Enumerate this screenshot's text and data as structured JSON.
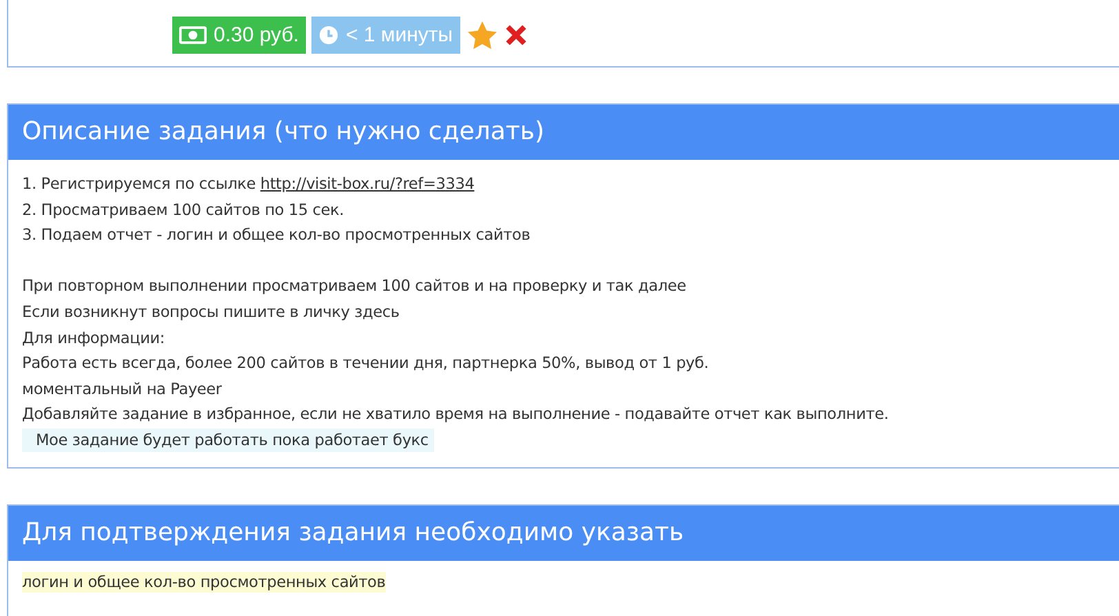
{
  "task_meta": {
    "price": "0.30 руб.",
    "duration": "< 1 минуты",
    "favorite": true
  },
  "description": {
    "title": "Описание задания (что нужно сделать)",
    "steps": [
      {
        "text": "1. Регистрируемся по ссылке ",
        "link": "http://visit-box.ru/?ref=3334"
      },
      {
        "text": "2. Просматриваем 100 сайтов по 15 сек."
      },
      {
        "text": "3. Подаем отчет - логин и общее кол-во просмотренных сайтов"
      }
    ],
    "notes": [
      {
        "text": "При повторном выполнении просматриваем 100 сайтов и на проверку и так далее",
        "highlighted": false
      },
      {
        "text": "Если возникнут вопросы пишите в личку здесь",
        "highlighted": false
      },
      {
        "text": "Для информации:",
        "highlighted": false
      },
      {
        "text": "Работа есть всегда, более 200 сайтов в течении дня, партнерка 50%, вывод от 1 руб.",
        "highlighted": false
      },
      {
        "text": "моментальный на Payeer",
        "highlighted": false
      },
      {
        "text": "Добавляйте задание в избранное, если не хватило время на выполнение - подавайте отчет как выполните.",
        "highlighted": false
      },
      {
        "text": "Мое задание будет работать пока работает букс",
        "highlighted": true
      }
    ]
  },
  "confirmation": {
    "title": "Для подтверждения задания необходимо указать",
    "text": "логин и общее кол-во просмотренных сайтов"
  }
}
